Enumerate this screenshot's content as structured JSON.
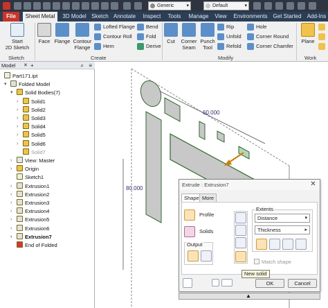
{
  "qat": {
    "style_combo": "Generic",
    "appearance_combo": "Default",
    "file_tab": "File"
  },
  "tabs": [
    {
      "label": "Sheet Metal",
      "active": true
    },
    {
      "label": "3D Model"
    },
    {
      "label": "Sketch"
    },
    {
      "label": "Annotate"
    },
    {
      "label": "Inspect"
    },
    {
      "label": "Tools"
    },
    {
      "label": "Manage"
    },
    {
      "label": "View"
    },
    {
      "label": "Environments"
    },
    {
      "label": "Get Started"
    },
    {
      "label": "Add-Ins"
    }
  ],
  "ribbon": {
    "sketch_panel": {
      "label": "Sketch",
      "start_sketch": "Start\n2D Sketch"
    },
    "create_panel": {
      "label": "Create",
      "face": "Face",
      "flange": "Flange",
      "contour_flange": "Contour\nFlange",
      "lofted_flange": "Lofted Flange",
      "contour_roll": "Contour Roll",
      "hem": "Hem",
      "bend": "Bend",
      "fold": "Fold",
      "derive": "Derive"
    },
    "modify_panel": {
      "label": "Modify",
      "cut": "Cut",
      "corner_seam": "Corner\nSeam",
      "punch_tool": "Punch\nTool",
      "rip": "Rip",
      "unfold": "Unfold",
      "refold": "Refold",
      "hole": "Hole",
      "corner_round": "Corner Round",
      "corner_chamfer": "Corner Chamfer"
    },
    "work_panel": {
      "label": "Work Feat",
      "plane": "Plane"
    }
  },
  "browser": {
    "header": "Model",
    "items": [
      {
        "label": "Part171.ipt",
        "indent": 0,
        "icon": "part-icon",
        "exp": ""
      },
      {
        "label": "Folded Model",
        "indent": 1,
        "icon": "folded-model-icon",
        "exp": "▾"
      },
      {
        "label": "Solid Bodies(7)",
        "indent": 2,
        "icon": "folder-icon",
        "exp": "▾"
      },
      {
        "label": "Solid1",
        "indent": 3,
        "icon": "solid-body-icon",
        "exp": "›"
      },
      {
        "label": "Solid2",
        "indent": 3,
        "icon": "solid-body-icon",
        "exp": "›"
      },
      {
        "label": "Solid3",
        "indent": 3,
        "icon": "solid-body-icon",
        "exp": "›"
      },
      {
        "label": "Solid4",
        "indent": 3,
        "icon": "solid-body-icon",
        "exp": "›"
      },
      {
        "label": "Solid5",
        "indent": 3,
        "icon": "solid-body-icon",
        "exp": "›"
      },
      {
        "label": "Solid6",
        "indent": 3,
        "icon": "solid-body-icon",
        "exp": "›"
      },
      {
        "label": "Solid7",
        "indent": 3,
        "icon": "solid-body-icon",
        "exp": "",
        "dim": true
      },
      {
        "label": "View: Master",
        "indent": 2,
        "icon": "view-icon",
        "exp": "›"
      },
      {
        "label": "Origin",
        "indent": 2,
        "icon": "folder-icon",
        "exp": "›"
      },
      {
        "label": "Sketch1",
        "indent": 2,
        "icon": "sketch-icon",
        "exp": ""
      },
      {
        "label": "Extrusion1",
        "indent": 2,
        "icon": "extrusion-icon",
        "exp": "›"
      },
      {
        "label": "Extrusion2",
        "indent": 2,
        "icon": "extrusion-icon",
        "exp": "›"
      },
      {
        "label": "Extrusion3",
        "indent": 2,
        "icon": "extrusion-icon",
        "exp": "›"
      },
      {
        "label": "Extrusion4",
        "indent": 2,
        "icon": "extrusion-icon",
        "exp": "›"
      },
      {
        "label": "Extrusion5",
        "indent": 2,
        "icon": "extrusion-icon",
        "exp": "›"
      },
      {
        "label": "Extrusion6",
        "indent": 2,
        "icon": "extrusion-icon",
        "exp": "›"
      },
      {
        "label": "Extrusion7",
        "indent": 2,
        "icon": "extrusion-icon",
        "exp": "›",
        "bold": true
      },
      {
        "label": "End of Folded",
        "indent": 2,
        "icon": "end-of-part-icon",
        "exp": ""
      }
    ]
  },
  "viewport": {
    "dim_horizontal": "60.000",
    "dim_vertical": "80.000"
  },
  "dialog": {
    "title": "Extrude : Extrusion7",
    "tab_shape": "Shape",
    "tab_more": "More",
    "profile": "Profile",
    "solids": "Solids",
    "output": "Output",
    "extents": "Extents",
    "extents_type": "Distance",
    "extents_value": "Thickness",
    "match_shape": "Match shape",
    "ok": "OK",
    "cancel": "Cancel"
  },
  "tooltip": "New solid",
  "colors": {
    "accent": "#f5b300",
    "ribbon_tab_bar": "#2b3e55",
    "file_tab": "#c8332a",
    "sheet_face": "#c8c8c8",
    "sheet_edge": "#2f6b2a"
  }
}
